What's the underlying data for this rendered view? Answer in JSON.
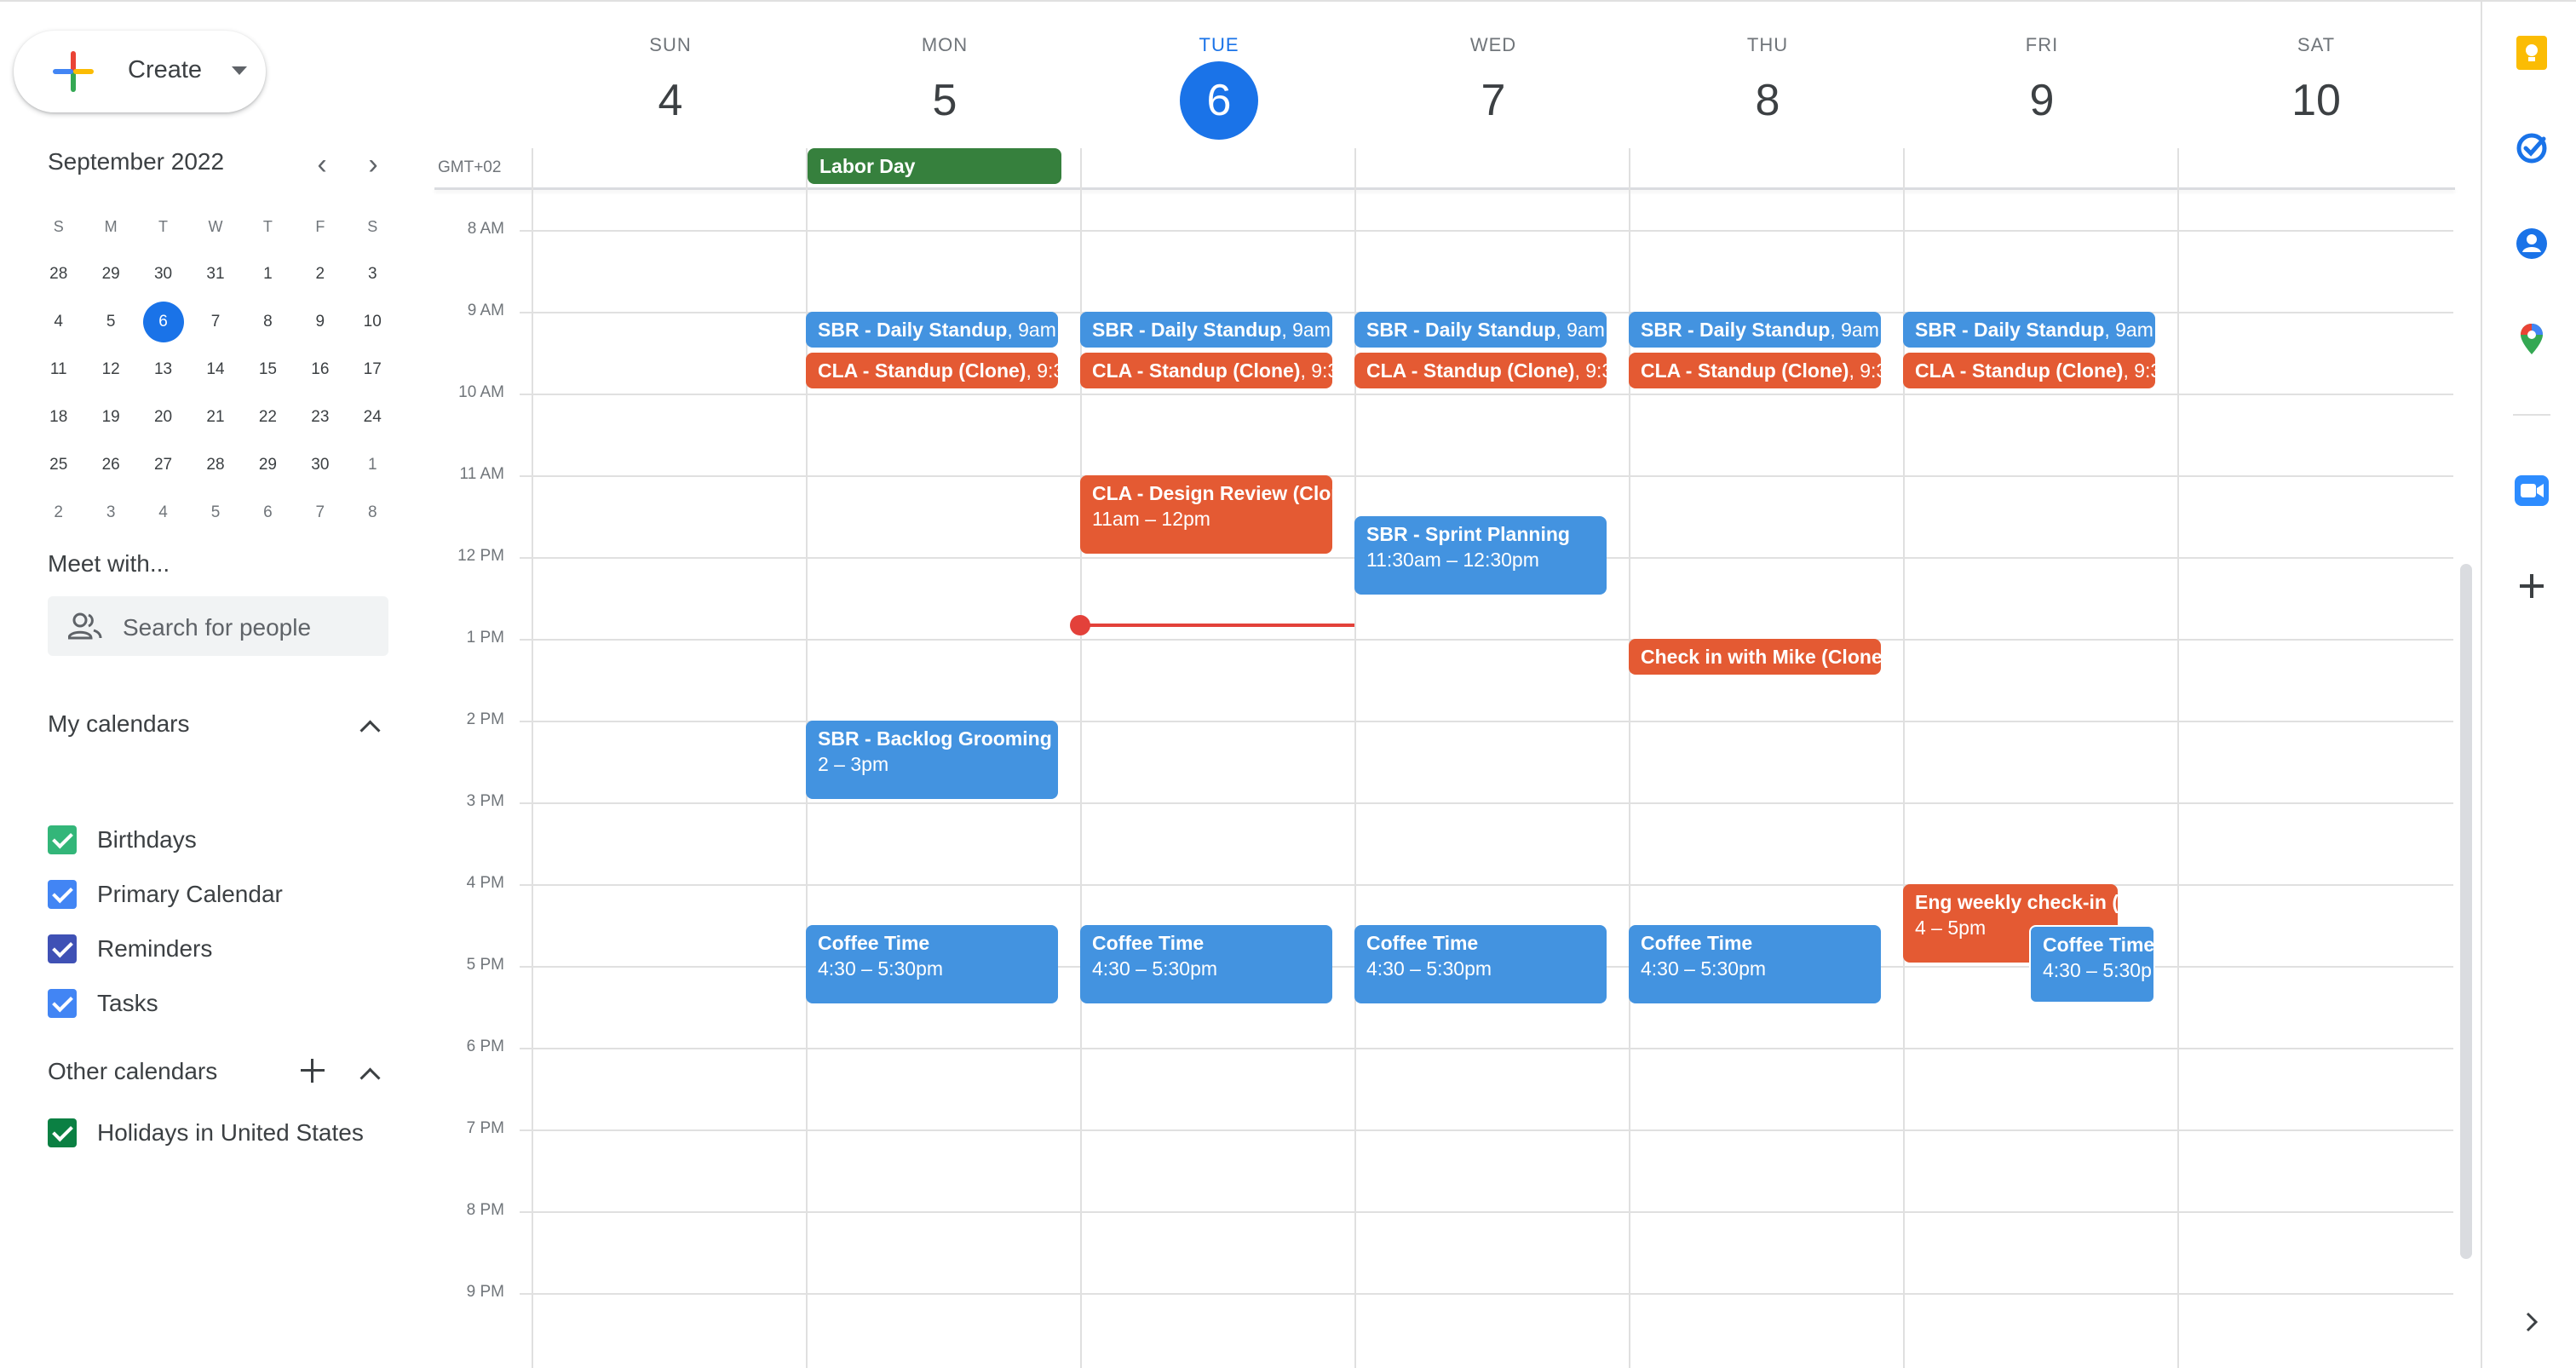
{
  "create_button": {
    "label": "Create"
  },
  "mini_calendar": {
    "month_label": "September 2022",
    "prev_icon": "chevron-left-icon",
    "next_icon": "chevron-right-icon",
    "weekday_headers": [
      "S",
      "M",
      "T",
      "W",
      "T",
      "F",
      "S"
    ],
    "weeks": [
      [
        "28",
        "29",
        "30",
        "31",
        "1",
        "2",
        "3"
      ],
      [
        "4",
        "5",
        "6",
        "7",
        "8",
        "9",
        "10"
      ],
      [
        "11",
        "12",
        "13",
        "14",
        "15",
        "16",
        "17"
      ],
      [
        "18",
        "19",
        "20",
        "21",
        "22",
        "23",
        "24"
      ],
      [
        "25",
        "26",
        "27",
        "28",
        "29",
        "30",
        "1"
      ],
      [
        "2",
        "3",
        "4",
        "5",
        "6",
        "7",
        "8"
      ]
    ],
    "today": "6"
  },
  "meet_with": {
    "title": "Meet with...",
    "search_placeholder": "Search for people"
  },
  "my_calendars": {
    "title": "My calendars",
    "items": [
      {
        "label": "Birthdays",
        "color": "#33b679"
      },
      {
        "label": "Primary Calendar",
        "color": "#4285f4"
      },
      {
        "label": "Reminders",
        "color": "#3f51b5"
      },
      {
        "label": "Tasks",
        "color": "#4285f4"
      }
    ]
  },
  "other_calendars": {
    "title": "Other calendars",
    "items": [
      {
        "label": "Holidays in United States",
        "color": "#0b8043"
      }
    ]
  },
  "week": {
    "timezone": "GMT+02",
    "days": [
      {
        "dow": "SUN",
        "num": "4"
      },
      {
        "dow": "MON",
        "num": "5"
      },
      {
        "dow": "TUE",
        "num": "6"
      },
      {
        "dow": "WED",
        "num": "7"
      },
      {
        "dow": "THU",
        "num": "8"
      },
      {
        "dow": "FRI",
        "num": "9"
      },
      {
        "dow": "SAT",
        "num": "10"
      }
    ],
    "today_index": 2,
    "hours": [
      "8 AM",
      "9 AM",
      "10 AM",
      "11 AM",
      "12 PM",
      "1 PM",
      "2 PM",
      "3 PM",
      "4 PM",
      "5 PM",
      "6 PM",
      "7 PM",
      "8 PM",
      "9 PM"
    ]
  },
  "events": {
    "labor_day": {
      "title": "Labor Day"
    },
    "mon_standup": {
      "title": "SBR - Daily Standup",
      "time": "9am"
    },
    "tue_standup": {
      "title": "SBR - Daily Standup",
      "time": "9am"
    },
    "wed_standup": {
      "title": "SBR - Daily Standup",
      "time": "9am"
    },
    "thu_standup": {
      "title": "SBR - Daily Standup",
      "time": "9am"
    },
    "fri_standup": {
      "title": "SBR - Daily Standup",
      "time": "9am"
    },
    "mon_cla": {
      "title": "CLA - Standup (Clone)",
      "time": "9:3"
    },
    "tue_cla": {
      "title": "CLA - Standup (Clone)",
      "time": "9:3"
    },
    "wed_cla": {
      "title": "CLA - Standup (Clone)",
      "time": "9:3"
    },
    "thu_cla": {
      "title": "CLA - Standup (Clone)",
      "time": "9:3"
    },
    "fri_cla": {
      "title": "CLA - Standup (Clone)",
      "time": "9:3"
    },
    "design_review": {
      "title": "CLA - Design Review (Clon",
      "time": "11am – 12pm"
    },
    "sprint_planning": {
      "title": "SBR - Sprint Planning",
      "time": "11:30am – 12:30pm"
    },
    "check_in_mike": {
      "title": "Check in with Mike (Clone"
    },
    "backlog_grooming": {
      "title": "SBR - Backlog Grooming",
      "time": "2 – 3pm"
    },
    "eng_weekly": {
      "title": "Eng weekly check-in (",
      "time": "4 – 5pm"
    },
    "coffee_mon": {
      "title": "Coffee Time",
      "time": "4:30 – 5:30pm"
    },
    "coffee_tue": {
      "title": "Coffee Time",
      "time": "4:30 – 5:30pm"
    },
    "coffee_wed": {
      "title": "Coffee Time",
      "time": "4:30 – 5:30pm"
    },
    "coffee_thu": {
      "title": "Coffee Time",
      "time": "4:30 – 5:30pm"
    },
    "coffee_fri": {
      "title": "Coffee Time",
      "time": "4:30 – 5:30p"
    }
  },
  "event_colors": {
    "sbr": "#4393e0",
    "cla": "#e45a33",
    "holiday": "#36803d",
    "now_line": "#e3413a"
  },
  "rail_icons": [
    "keep-icon",
    "tasks-icon",
    "contacts-icon",
    "maps-icon",
    "zoom-icon",
    "add-icon",
    "expand-icon"
  ]
}
